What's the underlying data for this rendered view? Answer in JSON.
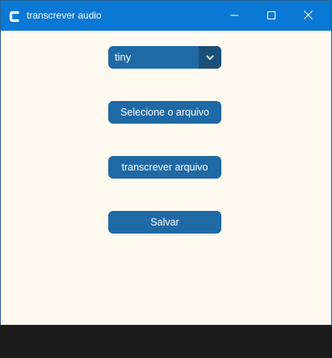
{
  "window": {
    "title": "transcrever audio",
    "icon": "app-c-icon",
    "controls": {
      "minimize_icon": "minimize-icon",
      "maximize_icon": "maximize-icon",
      "close_icon": "close-icon"
    }
  },
  "model_select": {
    "value": "tiny",
    "arrow_icon": "chevron-down-icon"
  },
  "buttons": {
    "select_file": "Selecione o arquivo",
    "transcribe": "transcrever arquivo",
    "save": "Salvar"
  },
  "colors": {
    "titlebar": "#0a78d4",
    "background": "#fffaf0",
    "button": "#1f69a5",
    "combo_arrow": "#1b4f79"
  }
}
